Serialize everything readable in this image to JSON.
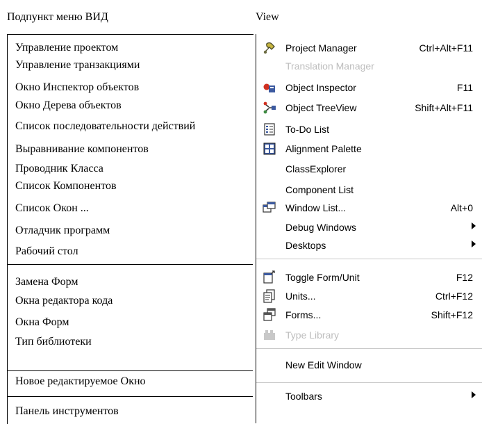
{
  "headers": {
    "left": "Подпункт меню ВИД",
    "right": "View"
  },
  "russian_items": [
    "Управление проектом",
    "Управление транзакциями",
    "Окно Инспектор объектов",
    "Окно Дерева объектов",
    "Список последовательности действий",
    "Выравнивание компонентов",
    "Проводник Класса",
    "Список Компонентов",
    "Список Окон  ...",
    "Отладчик программ",
    "Рабочий стол",
    "Замена Форм",
    "Окна редактора кода",
    "Окна Форм",
    "Тип библиотеки",
    "Новое редактируемое Окно",
    "Панель инструментов"
  ],
  "menu": {
    "items": [
      {
        "label": "Project Manager",
        "shortcut": "Ctrl+Alt+F11",
        "icon": "project-manager-icon",
        "enabled": true
      },
      {
        "label": "Translation Manager",
        "shortcut": "",
        "icon": "",
        "enabled": false
      },
      {
        "label": "Object Inspector",
        "shortcut": "F11",
        "icon": "object-inspector-icon",
        "enabled": true
      },
      {
        "label": "Object TreeView",
        "shortcut": "Shift+Alt+F11",
        "icon": "object-treeview-icon",
        "enabled": true
      },
      {
        "label": "To-Do List",
        "shortcut": "",
        "icon": "todo-list-icon",
        "enabled": true
      },
      {
        "label": "Alignment Palette",
        "shortcut": "",
        "icon": "alignment-palette-icon",
        "enabled": true
      },
      {
        "label": "ClassExplorer",
        "shortcut": "",
        "icon": "",
        "enabled": true
      },
      {
        "label": "Component List",
        "shortcut": "",
        "icon": "",
        "enabled": true
      },
      {
        "label": "Window List...",
        "shortcut": "Alt+0",
        "icon": "window-list-icon",
        "enabled": true
      },
      {
        "label": "Debug Windows",
        "shortcut": "",
        "icon": "",
        "enabled": true,
        "submenu": true
      },
      {
        "label": "Desktops",
        "shortcut": "",
        "icon": "",
        "enabled": true,
        "submenu": true
      },
      {
        "label": "Toggle Form/Unit",
        "shortcut": "F12",
        "icon": "toggle-form-unit-icon",
        "enabled": true
      },
      {
        "label": "Units...",
        "shortcut": "Ctrl+F12",
        "icon": "units-icon",
        "enabled": true
      },
      {
        "label": "Forms...",
        "shortcut": "Shift+F12",
        "icon": "forms-icon",
        "enabled": true
      },
      {
        "label": "Type Library",
        "shortcut": "",
        "icon": "type-library-icon",
        "enabled": false
      },
      {
        "label": "New Edit Window",
        "shortcut": "",
        "icon": "",
        "enabled": true
      },
      {
        "label": "Toolbars",
        "shortcut": "",
        "icon": "",
        "enabled": true,
        "submenu": true
      }
    ]
  },
  "colors": {
    "disabled_text": "#bdbdbd",
    "separator": "#c8c8c8",
    "icon_blue": "#3c5aa0"
  }
}
